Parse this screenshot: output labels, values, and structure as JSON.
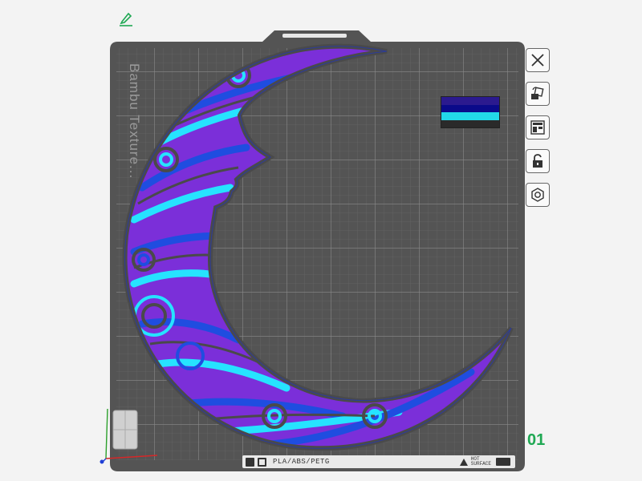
{
  "plate": {
    "texture_label": "Bambu Texture...",
    "number": "01",
    "filament_info": "PLA/ABS/PETG",
    "surface_label_line1": "HOT",
    "surface_label_line2": "SURFACE"
  },
  "filament_colors": [
    "#2b1a8f",
    "#0a0a8a",
    "#22d8e8",
    "#2a2a2a"
  ],
  "model_colors": {
    "outline": "#4a4a4a",
    "purple": "#7b2fd9",
    "blue": "#1f4de0",
    "cyan": "#26e3ff"
  },
  "toolbar": {
    "tools": [
      {
        "name": "close-plate-button",
        "icon": "close-icon"
      },
      {
        "name": "auto-orient-button",
        "icon": "auto-orient-icon"
      },
      {
        "name": "arrange-button",
        "icon": "arrange-icon"
      },
      {
        "name": "lock-button",
        "icon": "unlock-icon"
      },
      {
        "name": "plate-settings-button",
        "icon": "hex-nut-icon"
      }
    ]
  }
}
